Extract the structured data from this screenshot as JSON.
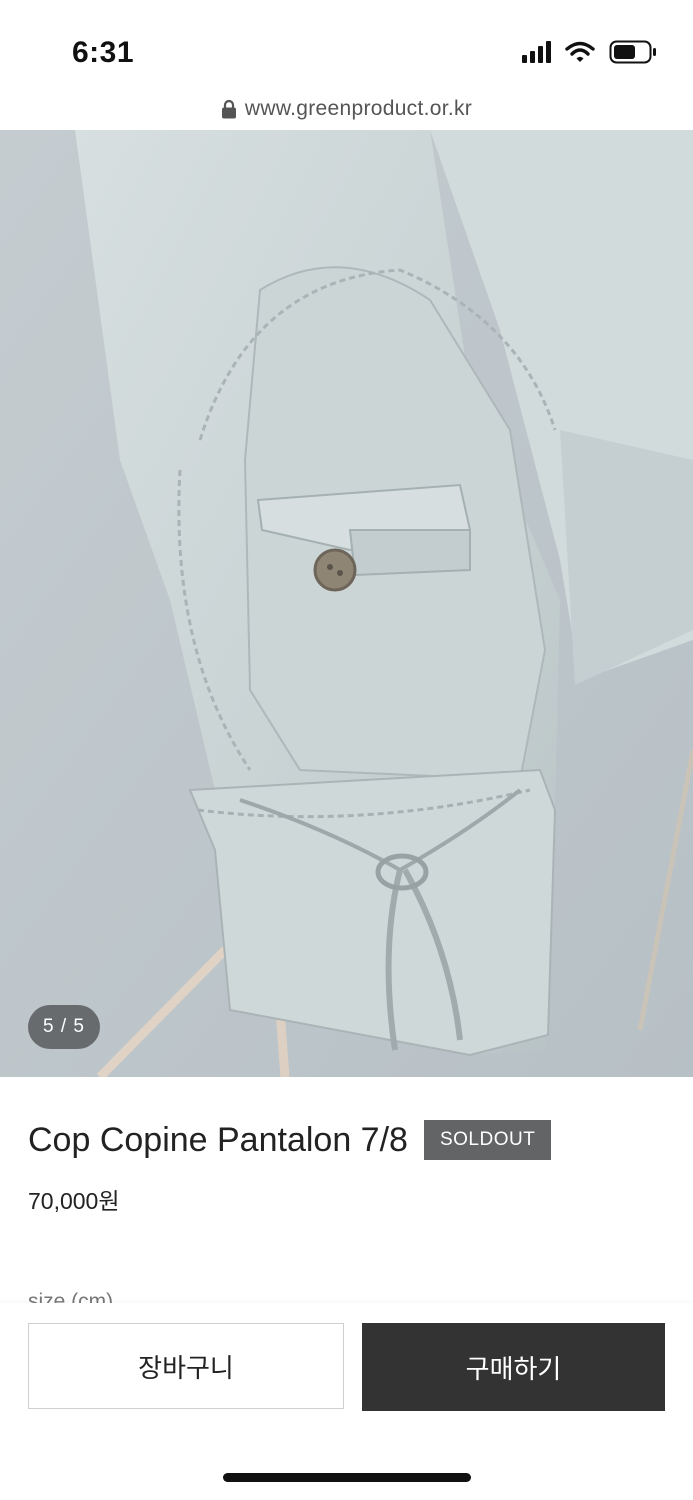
{
  "status_bar": {
    "time": "6:31",
    "icons": [
      "cellular-signal-icon",
      "wifi-icon",
      "battery-icon"
    ]
  },
  "browser": {
    "url": "www.greenproduct.or.kr",
    "lock_icon": "lock-icon"
  },
  "gallery": {
    "counter": "5 / 5"
  },
  "product": {
    "title": "Cop Copine Pantalon 7/8",
    "badge": "SOLDOUT",
    "price": "70,000원",
    "size_label": "size (cm)"
  },
  "actions": {
    "cart_label": "장바구니",
    "buy_label": "구매하기"
  },
  "colors": {
    "badge_bg": "#636466",
    "buy_bg": "#333333",
    "fabric": "#c7d1d3"
  }
}
